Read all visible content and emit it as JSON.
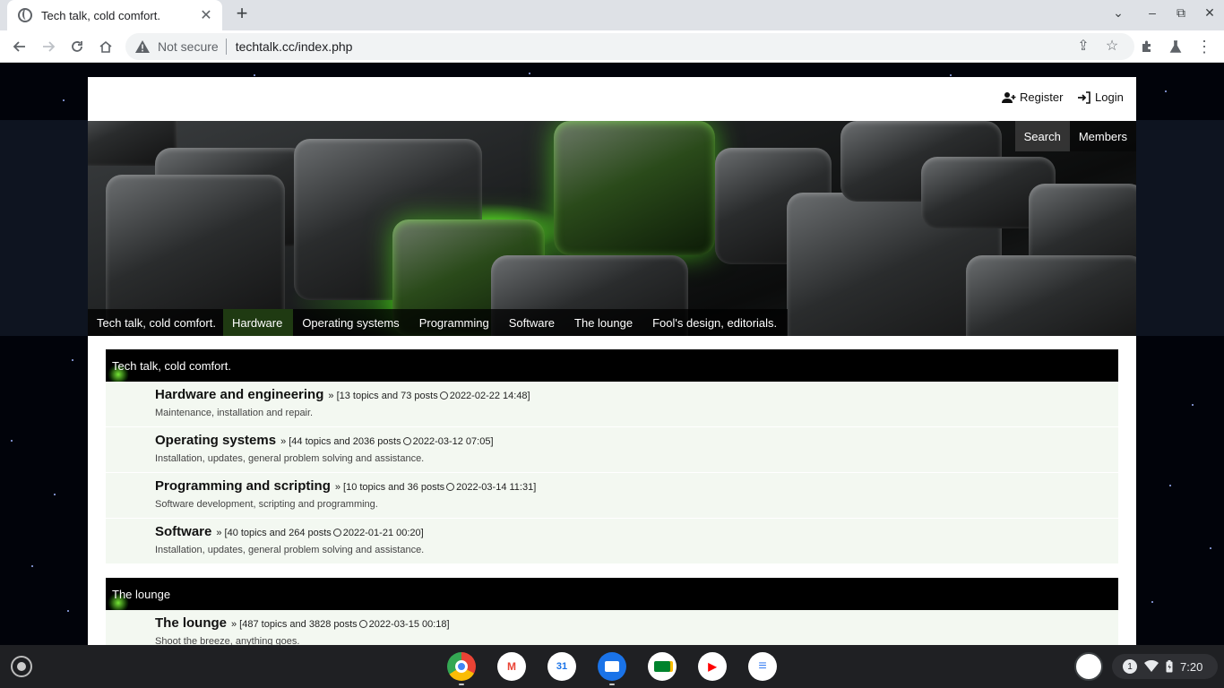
{
  "browser": {
    "tab_title": "Tech talk, cold comfort.",
    "tab_close": "✕",
    "new_tab": "+",
    "not_secure": "Not secure",
    "url": "techtalk.cc/index.php"
  },
  "site": {
    "top_links": {
      "register": "Register",
      "login": "Login"
    },
    "banner_nav": [
      "Search",
      "Members"
    ],
    "main_nav": [
      {
        "label": "Tech talk, cold comfort.",
        "active": false
      },
      {
        "label": "Hardware",
        "active": true
      },
      {
        "label": "Operating systems",
        "active": false
      },
      {
        "label": "Programming",
        "active": false
      },
      {
        "label": "Software",
        "active": false
      },
      {
        "label": "The lounge",
        "active": false
      },
      {
        "label": "Fool's design, editorials.",
        "active": false
      }
    ],
    "categories": [
      {
        "title": "Tech talk, cold comfort.",
        "forums": [
          {
            "name": "Hardware and engineering",
            "meta_prefix": "» [13 topics and 73 posts",
            "last_post": "2022-02-22 14:48]",
            "desc": "Maintenance, installation and repair."
          },
          {
            "name": "Operating systems",
            "meta_prefix": "» [44 topics and 2036 posts",
            "last_post": "2022-03-12 07:05]",
            "desc": "Installation, updates, general problem solving and assistance."
          },
          {
            "name": "Programming and scripting",
            "meta_prefix": "» [10 topics and 36 posts",
            "last_post": "2022-03-14 11:31]",
            "desc": "Software development, scripting and programming."
          },
          {
            "name": "Software",
            "meta_prefix": "» [40 topics and 264 posts",
            "last_post": "2022-01-21 00:20]",
            "desc": "Installation, updates, general problem solving and assistance."
          }
        ]
      },
      {
        "title": "The lounge",
        "forums": [
          {
            "name": "The lounge",
            "meta_prefix": "» [487 topics and 3828 posts",
            "last_post": "2022-03-15 00:18]",
            "desc": "Shoot the breeze, anything goes."
          }
        ]
      }
    ]
  },
  "shelf": {
    "apps": [
      {
        "name": "chrome-app",
        "label": ""
      },
      {
        "name": "gmail-app",
        "label": "M"
      },
      {
        "name": "calendar-app",
        "label": "31"
      },
      {
        "name": "files-app",
        "label": ""
      },
      {
        "name": "meet-app",
        "label": ""
      },
      {
        "name": "youtube-app",
        "label": "▶"
      },
      {
        "name": "docs-app",
        "label": "≡"
      }
    ],
    "notification_count": "1",
    "time": "7:20"
  }
}
